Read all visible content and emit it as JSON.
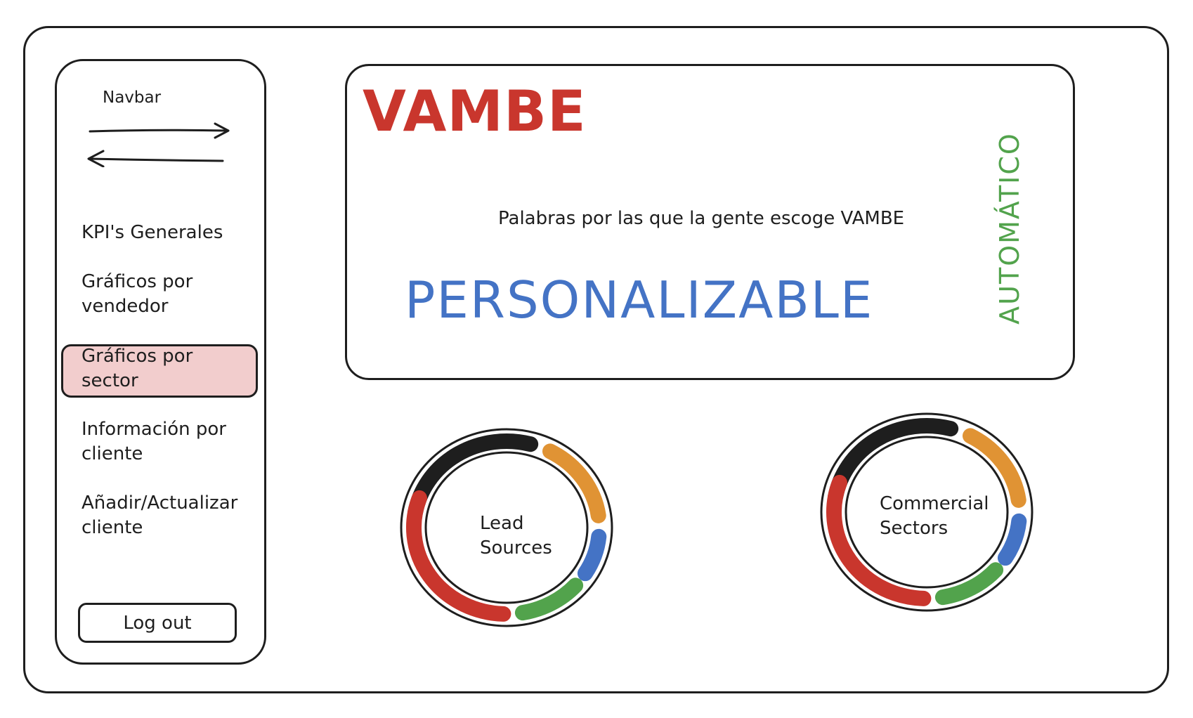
{
  "sidebar": {
    "title": "Navbar",
    "items": [
      {
        "label": "KPI's Generales"
      },
      {
        "label_line1": "Gráficos por",
        "label_line2": "vendedor"
      },
      {
        "label_line1": "Gráficos por",
        "label_line2": "sector"
      },
      {
        "label_line1": "Información por",
        "label_line2": "cliente"
      },
      {
        "label_line1": "Añadir/Actualizar",
        "label_line2": "cliente"
      }
    ],
    "active_index": 2,
    "active_color": "#f2cdcd",
    "logout_label": "Log out"
  },
  "hero": {
    "brand": "VAMBE",
    "brand_color": "#c9362d",
    "tagline": "Palabras por las que la gente escoge VAMBE",
    "word_primary": "PERSONALIZABLE",
    "word_primary_color": "#4473c5",
    "word_secondary": "AUTOMÁTICO",
    "word_secondary_color": "#52a34c"
  },
  "charts": [
    {
      "label_line1": "Lead",
      "label_line2": "Sources"
    },
    {
      "label_line1": "Commercial",
      "label_line2": "Sectors"
    }
  ],
  "chart_data": [
    {
      "type": "pie",
      "title": "Lead Sources",
      "segment_colors": [
        "#1e1e1e",
        "#e09334",
        "#4473c5",
        "#52a34c",
        "#c9362d"
      ]
    },
    {
      "type": "pie",
      "title": "Commercial Sectors",
      "segment_colors": [
        "#1e1e1e",
        "#e09334",
        "#4473c5",
        "#52a34c",
        "#c9362d"
      ]
    }
  ]
}
